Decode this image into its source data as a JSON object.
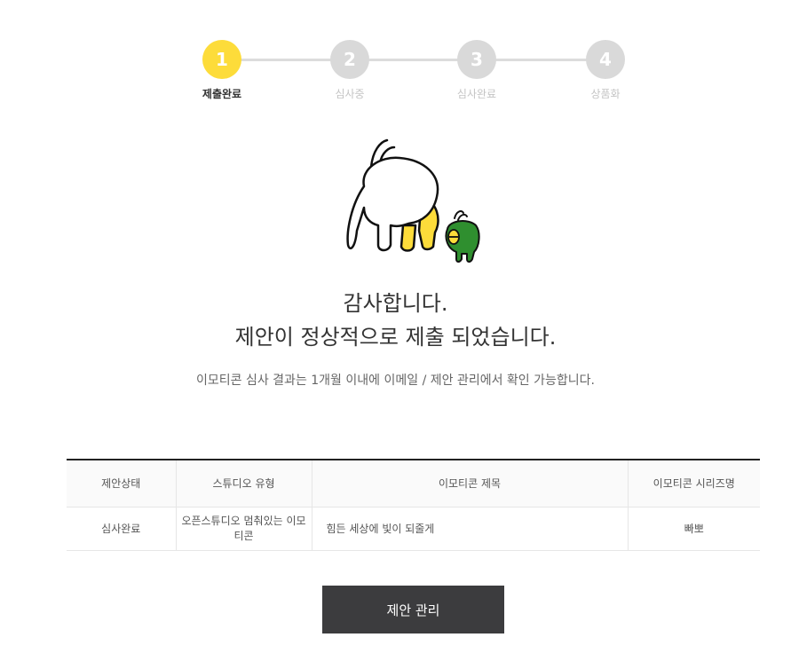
{
  "stepper": {
    "steps": [
      {
        "number": "1",
        "label": "제출완료",
        "active": true
      },
      {
        "number": "2",
        "label": "심사중",
        "active": false
      },
      {
        "number": "3",
        "label": "심사완료",
        "active": false
      },
      {
        "number": "4",
        "label": "상품화",
        "active": false
      }
    ]
  },
  "message": {
    "line1": "감사합니다.",
    "line2": "제안이 정상적으로 제출 되었습니다.",
    "note": "이모티콘 심사 결과는 1개월 이내에 이메일 / 제안 관리에서 확인 가능합니다."
  },
  "table": {
    "headers": [
      "제안상태",
      "스튜디오 유형",
      "이모티콘 제목",
      "이모티콘 시리즈명"
    ],
    "rows": [
      [
        "심사완료",
        "오픈스튜디오 멈춰있는 이모티콘",
        "힘든 세상에 빛이 되줄게",
        "빠뽀"
      ]
    ]
  },
  "actions": {
    "manage_label": "제안 관리"
  },
  "colors": {
    "accent": "#fddc3a",
    "inactive": "#d9d9d9",
    "button_bg": "#3c3c3e"
  }
}
